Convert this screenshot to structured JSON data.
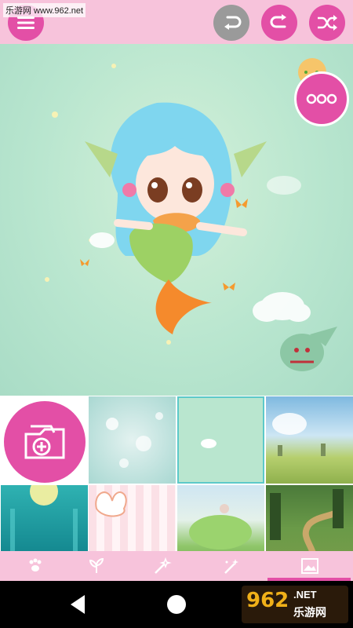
{
  "watermark": {
    "text": "乐游网 www.962.net"
  },
  "toolbar": {
    "menu_icon": "list-icon",
    "undo_icon": "undo-icon",
    "redo_icon": "redo-icon",
    "shuffle_icon": "shuffle-icon"
  },
  "scene": {
    "more_icon": "more-dots-icon"
  },
  "backgrounds": [
    {
      "name": "add-photo",
      "icon": "add-folder-icon"
    },
    {
      "name": "snow-blossom"
    },
    {
      "name": "moon-mint",
      "selected": true
    },
    {
      "name": "field-sky"
    },
    {
      "name": "teal-lights"
    },
    {
      "name": "pink-bunny"
    },
    {
      "name": "green-hill"
    },
    {
      "name": "forest-path"
    }
  ],
  "tabs": [
    {
      "name": "pet-paw",
      "icon": "paw-icon"
    },
    {
      "name": "plants",
      "icon": "plant-icon"
    },
    {
      "name": "magic",
      "icon": "wand-icon"
    },
    {
      "name": "effects",
      "icon": "sparkle-wand-icon"
    },
    {
      "name": "background",
      "icon": "image-icon",
      "active": true
    }
  ],
  "branding": {
    "logo_text": "962",
    "logo_sub": ".NET",
    "logo_cn": "乐游网"
  },
  "colors": {
    "accent": "#e34fa6",
    "bar": "#f7c3db",
    "scene": "#b9e6cf",
    "selected": "#5cc9c9"
  }
}
